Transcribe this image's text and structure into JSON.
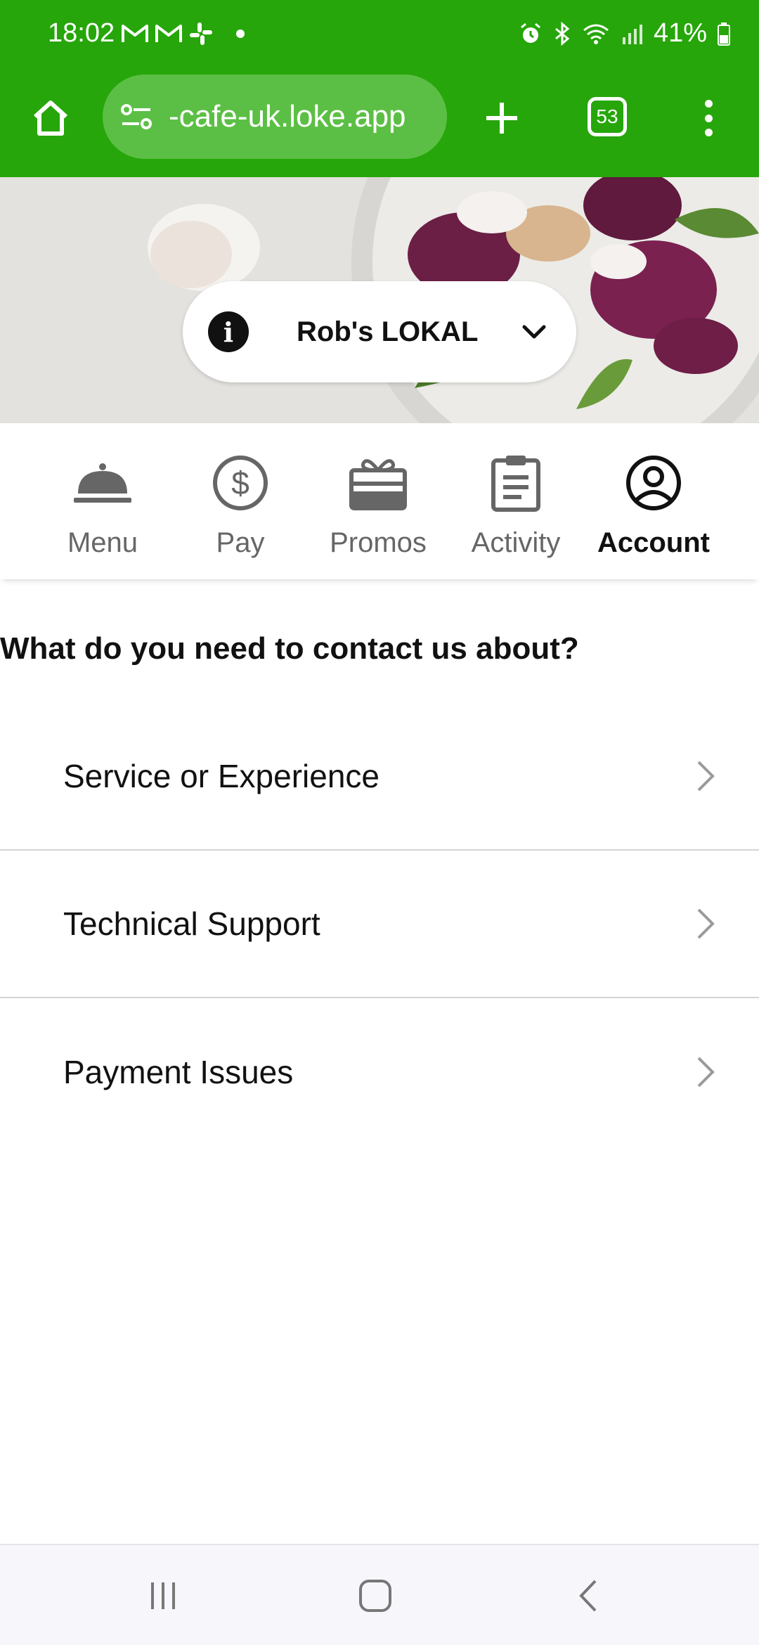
{
  "status_bar": {
    "time": "18:02",
    "left_icons": [
      "gmail-icon",
      "gmail-icon",
      "slack-icon"
    ],
    "right_icons": [
      "alarm-icon",
      "bluetooth-icon",
      "wifi-icon",
      "signal-icon"
    ],
    "battery": "41%"
  },
  "browser": {
    "url": "-cafe-uk.loke.app",
    "tab_count": "53",
    "theme_color": "#26a60a"
  },
  "venue": {
    "name": "Rob's LOKAL"
  },
  "tabs": [
    {
      "label": "Menu",
      "icon": "cloche-icon",
      "active": false
    },
    {
      "label": "Pay",
      "icon": "dollar-icon",
      "active": false
    },
    {
      "label": "Promos",
      "icon": "gift-card-icon",
      "active": false
    },
    {
      "label": "Activity",
      "icon": "clipboard-icon",
      "active": false
    },
    {
      "label": "Account",
      "icon": "account-icon",
      "active": true
    }
  ],
  "contact": {
    "question": "What do you need to contact us about?",
    "options": [
      {
        "label": "Service or Experience"
      },
      {
        "label": "Technical Support"
      },
      {
        "label": "Payment Issues"
      }
    ]
  },
  "system_nav": {
    "buttons": [
      "recents-icon",
      "home-icon",
      "back-icon"
    ]
  }
}
